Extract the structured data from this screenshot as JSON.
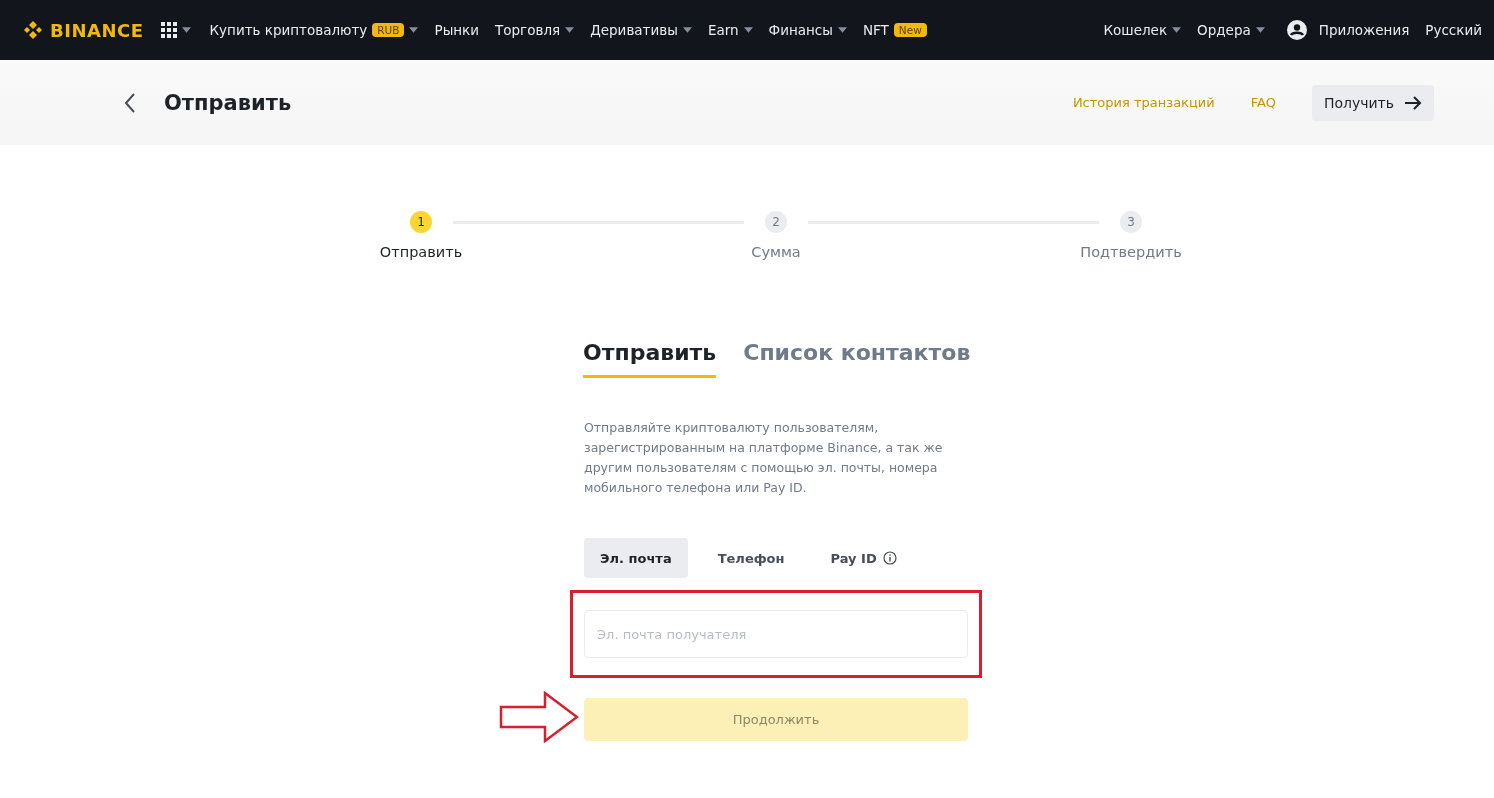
{
  "nav": {
    "logo": "BINANCE",
    "left": [
      {
        "label": "Купить криптовалюту",
        "badge": "RUB",
        "dropdown": true
      },
      {
        "label": "Рынки",
        "dropdown": false
      },
      {
        "label": "Торговля",
        "dropdown": true
      },
      {
        "label": "Деривативы",
        "dropdown": true
      },
      {
        "label": "Earn",
        "dropdown": true
      },
      {
        "label": "Финансы",
        "dropdown": true
      },
      {
        "label": "NFT",
        "badge": "New",
        "dropdown": false
      }
    ],
    "right": [
      {
        "label": "Кошелек",
        "dropdown": true
      },
      {
        "label": "Ордера",
        "dropdown": true
      }
    ],
    "apps": "Приложения",
    "language": "Русский"
  },
  "header": {
    "title": "Отправить",
    "links": [
      "История транзакций",
      "FAQ"
    ],
    "receive_button": "Получить"
  },
  "steps": [
    {
      "number": "1",
      "label": "Отправить",
      "active": true
    },
    {
      "number": "2",
      "label": "Сумма",
      "active": false
    },
    {
      "number": "3",
      "label": "Подтвердить",
      "active": false
    }
  ],
  "tabs": [
    {
      "label": "Отправить",
      "selected": true
    },
    {
      "label": "Список контактов",
      "selected": false
    }
  ],
  "description": "Отправляйте криптовалюту пользователям, зарегистрированным на платформе Binance, а так же другим пользователям с помощью эл. почты, номера мобильного телефона или Pay ID.",
  "methods": [
    {
      "label": "Эл. почта",
      "selected": true,
      "info": false
    },
    {
      "label": "Телефон",
      "selected": false,
      "info": false
    },
    {
      "label": "Pay ID",
      "selected": false,
      "info": true
    }
  ],
  "recipient": {
    "placeholder": "Эл. почта получателя",
    "highlighted": true
  },
  "continue_button": {
    "label": "Продолжить",
    "disabled": true
  },
  "pointer_arrow": true
}
